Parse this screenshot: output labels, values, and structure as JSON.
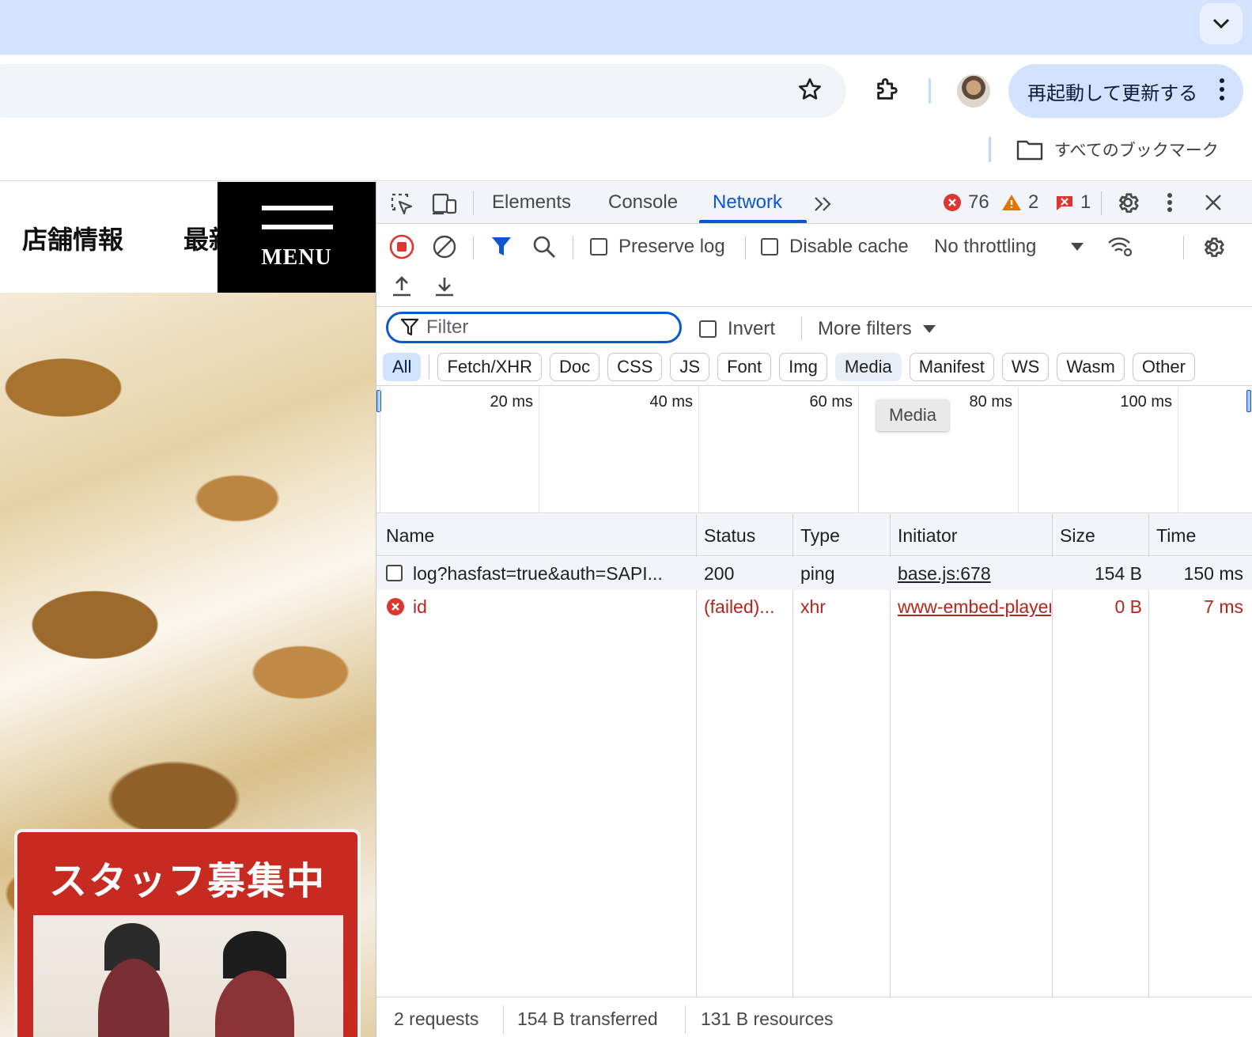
{
  "browser": {
    "update_button": "再起動して更新する",
    "all_bookmarks": "すべてのブックマーク"
  },
  "site": {
    "nav_shop_info": "店舗情報",
    "nav_news_partial": "最新",
    "menu_label": "MENU",
    "recruit_title": "スタッフ募集中"
  },
  "devtools": {
    "tabs": [
      "Elements",
      "Console",
      "Network"
    ],
    "active_tab": "Network",
    "errors_count": "76",
    "warnings_count": "2",
    "issues_count": "1",
    "preserve_log": "Preserve log",
    "disable_cache": "Disable cache",
    "throttling": "No throttling",
    "filter_placeholder": "Filter",
    "invert": "Invert",
    "more_filters": "More filters",
    "type_filters": [
      "All",
      "Fetch/XHR",
      "Doc",
      "CSS",
      "JS",
      "Font",
      "Img",
      "Media",
      "Manifest",
      "WS",
      "Wasm",
      "Other"
    ],
    "active_type_filter": "All",
    "hover_tooltip": "Media",
    "timeline_ticks": [
      "20 ms",
      "40 ms",
      "60 ms",
      "80 ms",
      "100 ms"
    ],
    "columns": [
      "Name",
      "Status",
      "Type",
      "Initiator",
      "Size",
      "Time"
    ],
    "rows": [
      {
        "name": "log?hasfast=true&auth=SAPI...",
        "status": "200",
        "type": "ping",
        "initiator": "base.js:678",
        "size": "154 B",
        "time": "150 ms",
        "failed": false
      },
      {
        "name": "id",
        "status": "(failed)...",
        "type": "xhr",
        "initiator": "www-embed-player",
        "size": "0 B",
        "time": "7 ms",
        "failed": true
      }
    ],
    "summary": {
      "requests": "2 requests",
      "transferred": "154 B transferred",
      "resources": "131 B resources"
    }
  },
  "colors": {
    "accent": "#0b57d0",
    "error": "#b3261e",
    "warning": "#e37400",
    "tabstrip": "#d3e3fd"
  }
}
